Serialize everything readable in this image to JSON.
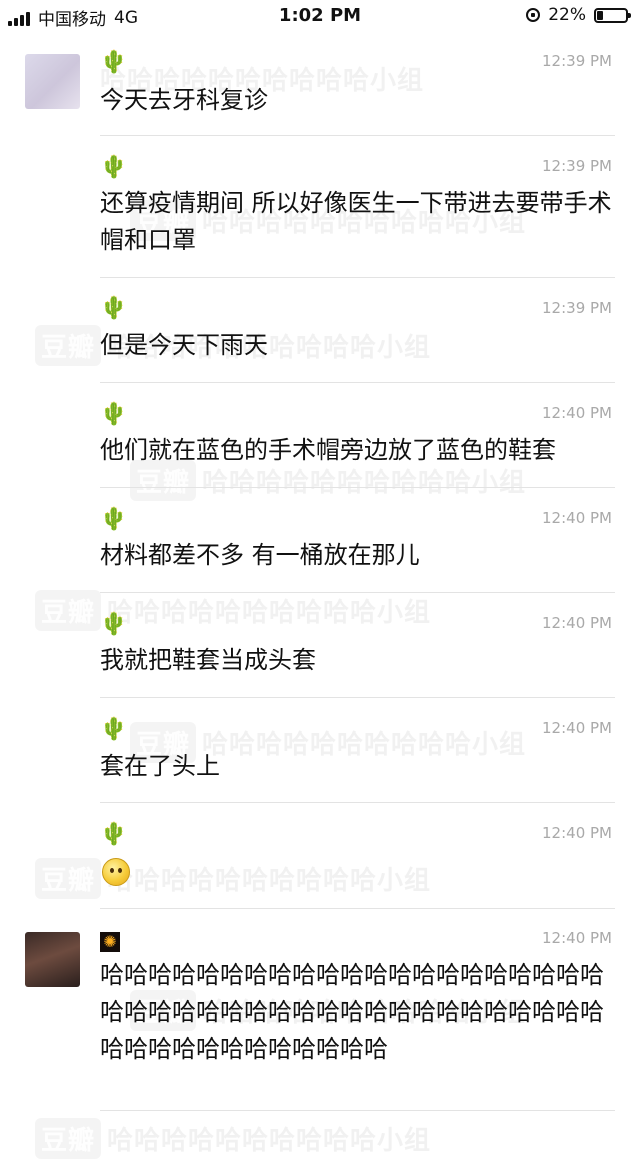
{
  "status_bar": {
    "carrier": "中国移动",
    "network": "4G",
    "time": "1:02 PM",
    "battery": "22%",
    "icons": [
      "signal-bars-icon",
      "rotation-lock-icon",
      "battery-icon"
    ]
  },
  "watermark": {
    "brand": "豆瓣",
    "text": "哈哈哈哈哈哈哈哈哈哈小组"
  },
  "messages": [
    {
      "time": "12:39 PM",
      "text": "今天去牙科复诊",
      "icon": "cactus-icon"
    },
    {
      "time": "12:39 PM",
      "text": "还算疫情期间 所以好像医生一下带进去要带手术帽和口罩",
      "icon": "cactus-icon"
    },
    {
      "time": "12:39 PM",
      "text": "但是今天下雨天",
      "icon": "cactus-icon"
    },
    {
      "time": "12:40 PM",
      "text": "他们就在蓝色的手术帽旁边放了蓝色的鞋套",
      "icon": "cactus-icon"
    },
    {
      "time": "12:40 PM",
      "text": "材料都差不多 有一桶放在那儿",
      "icon": "cactus-icon"
    },
    {
      "time": "12:40 PM",
      "text": "我就把鞋套当成头套",
      "icon": "cactus-icon"
    },
    {
      "time": "12:40 PM",
      "text": "套在了头上",
      "icon": "cactus-icon"
    },
    {
      "time": "12:40 PM",
      "text": "",
      "icon": "cactus-icon",
      "emoji": "smiling-face-emoji"
    },
    {
      "time": "12:40 PM",
      "text": "哈哈哈哈哈哈哈哈哈哈哈哈哈哈哈哈哈哈哈哈哈哈哈哈哈哈哈哈哈哈哈哈哈哈哈哈哈哈哈哈哈哈哈哈哈哈哈哈哈哈哈哈哈哈",
      "icon": "firework-icon"
    }
  ]
}
